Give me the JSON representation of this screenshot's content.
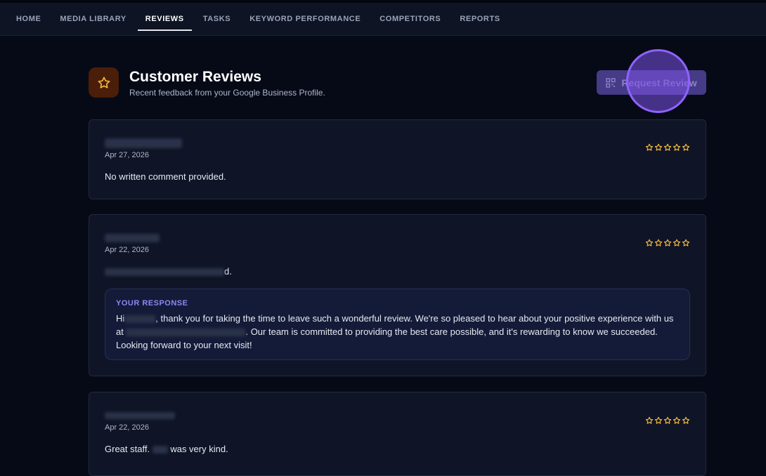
{
  "nav": {
    "items": [
      {
        "label": "HOME"
      },
      {
        "label": "MEDIA LIBRARY"
      },
      {
        "label": "REVIEWS"
      },
      {
        "label": "TASKS"
      },
      {
        "label": "KEYWORD PERFORMANCE"
      },
      {
        "label": "COMPETITORS"
      },
      {
        "label": "REPORTS"
      }
    ],
    "active": "REVIEWS"
  },
  "header": {
    "title": "Customer Reviews",
    "subtitle": "Recent feedback from your Google Business Profile.",
    "request_button": "Request Review",
    "icon": "star-icon"
  },
  "colors": {
    "background": "#060a17",
    "card": "#0f1526",
    "accent": "#8d86f4",
    "star": "#f4b740",
    "button": "#463b86"
  },
  "reviews": [
    {
      "reviewer": "",
      "date": "Apr 27, 2026",
      "rating": 0,
      "comment": "No written comment provided."
    },
    {
      "reviewer": "",
      "date": "Apr 22, 2026",
      "rating": 0,
      "comment_tail": "d.",
      "response": {
        "label": "YOUR RESPONSE",
        "part1": "Hi",
        "part2": ", thank you for taking the time to leave such a wonderful review. We're so pleased to hear about your positive experience with us at",
        "part3": ". Our team is committed to providing the best care possible, and it's rewarding to know we succeeded. Looking forward to your next visit!"
      }
    },
    {
      "reviewer": "",
      "date": "Apr 22, 2026",
      "rating": 0,
      "comment_part1": "Great staff.",
      "comment_part2": "was very kind."
    }
  ]
}
